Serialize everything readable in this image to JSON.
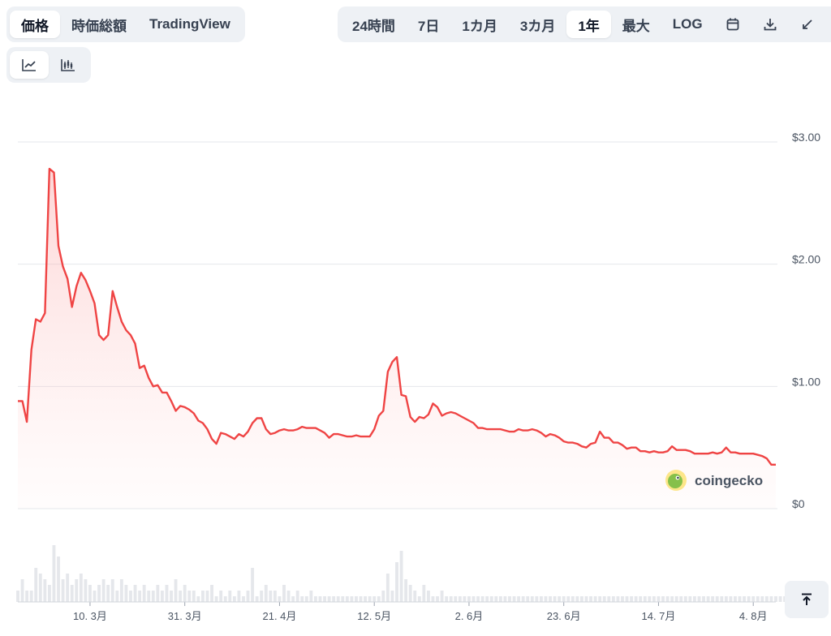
{
  "view_tabs": [
    {
      "label": "価格",
      "active": true
    },
    {
      "label": "時価総額",
      "active": false
    },
    {
      "label": "TradingView",
      "active": false
    }
  ],
  "range_tabs": [
    {
      "label": "24時間",
      "active": false
    },
    {
      "label": "7日",
      "active": false
    },
    {
      "label": "1カ月",
      "active": false
    },
    {
      "label": "3カ月",
      "active": false
    },
    {
      "label": "1年",
      "active": true
    },
    {
      "label": "最大",
      "active": false
    },
    {
      "label": "LOG",
      "active": false
    }
  ],
  "range_icons": [
    "calendar-icon",
    "download-icon",
    "expand-icon"
  ],
  "chart_type_icons": [
    "line-chart-icon",
    "candlestick-chart-icon"
  ],
  "watermark": {
    "text": "coingecko",
    "icon": "gecko-logo-icon"
  },
  "colors": {
    "line": "#ef4444",
    "fill": "#fecaca",
    "volume": "#e5e7eb",
    "grid": "#e5e7eb"
  },
  "chart_data": {
    "type": "line",
    "y_ticks": [
      "$3.00",
      "$2.00",
      "$1.00",
      "$0"
    ],
    "y_tick_values": [
      3,
      2,
      1,
      0
    ],
    "ylim": [
      0,
      3.0
    ],
    "x_ticks": [
      "10. 3月",
      "31. 3月",
      "21. 4月",
      "12. 5月",
      "2. 6月",
      "23. 6月",
      "14. 7月",
      "4. 8月"
    ],
    "x_tick_index": [
      16,
      37,
      58,
      79,
      100,
      121,
      142,
      163
    ],
    "grid": true,
    "price": [
      0.88,
      0.88,
      0.71,
      1.3,
      1.55,
      1.53,
      1.6,
      2.78,
      2.75,
      2.15,
      1.98,
      1.88,
      1.65,
      1.82,
      1.93,
      1.87,
      1.78,
      1.68,
      1.42,
      1.38,
      1.42,
      1.78,
      1.65,
      1.53,
      1.46,
      1.42,
      1.35,
      1.15,
      1.17,
      1.07,
      1.0,
      1.01,
      0.95,
      0.95,
      0.88,
      0.8,
      0.84,
      0.83,
      0.81,
      0.78,
      0.72,
      0.7,
      0.65,
      0.57,
      0.53,
      0.62,
      0.61,
      0.59,
      0.57,
      0.61,
      0.59,
      0.63,
      0.7,
      0.74,
      0.74,
      0.65,
      0.61,
      0.62,
      0.64,
      0.65,
      0.64,
      0.64,
      0.65,
      0.67,
      0.66,
      0.66,
      0.66,
      0.64,
      0.62,
      0.58,
      0.61,
      0.61,
      0.6,
      0.59,
      0.59,
      0.6,
      0.59,
      0.59,
      0.59,
      0.65,
      0.76,
      0.8,
      1.12,
      1.2,
      1.24,
      0.93,
      0.92,
      0.75,
      0.71,
      0.75,
      0.74,
      0.77,
      0.86,
      0.83,
      0.76,
      0.78,
      0.79,
      0.78,
      0.76,
      0.74,
      0.72,
      0.7,
      0.66,
      0.66,
      0.65,
      0.65,
      0.65,
      0.65,
      0.64,
      0.63,
      0.63,
      0.65,
      0.64,
      0.64,
      0.65,
      0.64,
      0.62,
      0.59,
      0.61,
      0.6,
      0.58,
      0.55,
      0.54,
      0.54,
      0.53,
      0.51,
      0.5,
      0.53,
      0.54,
      0.63,
      0.58,
      0.58,
      0.54,
      0.54,
      0.52,
      0.49,
      0.5,
      0.5,
      0.47,
      0.47,
      0.46,
      0.47,
      0.46,
      0.46,
      0.47,
      0.51,
      0.48,
      0.48,
      0.48,
      0.47,
      0.45,
      0.45,
      0.45,
      0.45,
      0.46,
      0.45,
      0.46,
      0.5,
      0.46,
      0.46,
      0.45,
      0.45,
      0.45,
      0.45,
      0.44,
      0.43,
      0.41,
      0.36,
      0.36
    ],
    "volume": [
      0.2,
      0.4,
      0.2,
      0.2,
      0.6,
      0.5,
      0.4,
      0.3,
      1.0,
      0.8,
      0.4,
      0.5,
      0.3,
      0.4,
      0.5,
      0.4,
      0.3,
      0.2,
      0.3,
      0.4,
      0.3,
      0.4,
      0.2,
      0.4,
      0.3,
      0.2,
      0.3,
      0.2,
      0.3,
      0.2,
      0.2,
      0.3,
      0.2,
      0.3,
      0.2,
      0.4,
      0.2,
      0.3,
      0.2,
      0.2,
      0.1,
      0.2,
      0.2,
      0.3,
      0.1,
      0.2,
      0.1,
      0.2,
      0.1,
      0.2,
      0.1,
      0.2,
      0.6,
      0.1,
      0.2,
      0.3,
      0.2,
      0.2,
      0.1,
      0.3,
      0.2,
      0.1,
      0.2,
      0.1,
      0.1,
      0.2,
      0.1,
      0.1,
      0.1,
      0.1,
      0.1,
      0.1,
      0.1,
      0.1,
      0.1,
      0.1,
      0.1,
      0.1,
      0.1,
      0.1,
      0.1,
      0.2,
      0.5,
      0.2,
      0.7,
      0.9,
      0.4,
      0.3,
      0.2,
      0.1,
      0.3,
      0.2,
      0.1,
      0.1,
      0.2,
      0.1,
      0.1,
      0.1,
      0.1,
      0.1,
      0.1,
      0.1,
      0.1,
      0.1,
      0.1,
      0.1,
      0.1,
      0.1,
      0.1,
      0.1,
      0.1,
      0.1,
      0.1,
      0.1,
      0.1,
      0.1,
      0.1,
      0.1,
      0.1,
      0.1,
      0.1,
      0.1,
      0.1,
      0.1,
      0.1,
      0.1,
      0.1,
      0.1,
      0.1,
      0.1,
      0.1,
      0.1,
      0.1,
      0.1,
      0.1,
      0.1,
      0.1,
      0.1,
      0.1,
      0.1,
      0.1,
      0.1,
      0.1,
      0.1,
      0.1,
      0.1,
      0.1,
      0.1,
      0.1,
      0.1,
      0.1,
      0.1,
      0.1,
      0.1,
      0.1,
      0.1,
      0.1,
      0.1,
      0.1,
      0.1,
      0.1,
      0.1,
      0.1,
      0.1,
      0.1,
      0.1,
      0.1,
      0.1,
      0.1,
      0.1,
      0.1,
      0.1,
      0.1,
      0.1
    ]
  }
}
